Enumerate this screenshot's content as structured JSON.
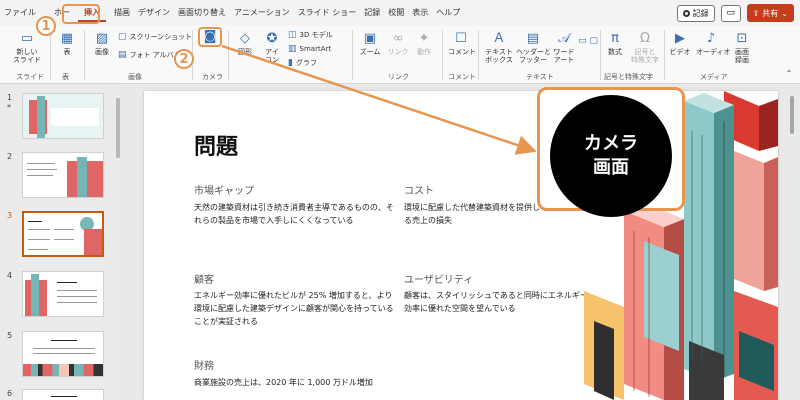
{
  "menubar": {
    "tabs": [
      "ファイル",
      "ホーム",
      "挿入",
      "画面切り替え",
      "デザイン",
      "画面切り替え",
      "アニメーション",
      "スライド ショー",
      "記録",
      "校閲",
      "表示",
      "ヘルプ"
    ],
    "active_tab_label": "挿入",
    "tab_file": "ファイル",
    "tab_home": "ホー",
    "tab_insert": "挿入",
    "tab_draw": "描画",
    "tab_design": "デザイン",
    "tab_transitions": "画面切り替え",
    "tab_animations": "アニメーション",
    "tab_slideshow": "スライド ショー",
    "tab_record": "記録",
    "tab_review": "校閲",
    "tab_view": "表示",
    "tab_help": "ヘルプ",
    "record_label": "記録",
    "share_label": "共有"
  },
  "ribbon": {
    "new_slide": "新しい\nスライド",
    "group_slides": "スライド",
    "table": "表",
    "group_table": "表",
    "images": "画像",
    "screenshot": "スクリーンショット",
    "photo_album": "フォト アルバム",
    "group_images": "画像",
    "group_camera": "カメラ",
    "shapes": "図形",
    "icons": "アイ\nコン",
    "model3d": "3D モデル",
    "smartart": "SmartArt",
    "chart": "グラフ",
    "zoom": "ズーム",
    "link": "リンク",
    "action": "動作",
    "group_link": "リンク",
    "comment": "コメント",
    "group_comment": "コメント",
    "textbox": "テキスト\nボックス",
    "header_footer": "ヘッダーと\nフッター",
    "wordart": "ワード\nアート",
    "group_text": "テキスト",
    "equation": "数式",
    "symbol": "記号と\n特殊文字",
    "group_symbols": "記号と特殊文字",
    "video": "ビデオ",
    "audio": "オーディオ",
    "screen_recording": "画面\n録画",
    "group_media": "メディア"
  },
  "thumbnails": [
    {
      "num": "1",
      "star": "*"
    },
    {
      "num": "2"
    },
    {
      "num": "3"
    },
    {
      "num": "4"
    },
    {
      "num": "5"
    },
    {
      "num": "6"
    }
  ],
  "slide": {
    "title": "問題",
    "sections": [
      {
        "heading": "市場ギャップ",
        "body": "天然の建築資材は引き続き消費者主導であるものの、それらの製品を市場で入手しにくくなっている"
      },
      {
        "heading": "コスト",
        "body": "環境に配慮した代替建築資材を提供しないことによる売上の損失"
      },
      {
        "heading": "顧客",
        "body": "エネルギー効率に優れたビルが 25% 増加すると、より環境に配慮した建築デザインに顧客が関心を持っていることが実証される"
      },
      {
        "heading": "ユーザビリティ",
        "body": "顧客は、スタイリッシュであると同時にエネルギー効率に優れた空間を望んでいる"
      },
      {
        "heading": "財務",
        "body": "商業施設の売上は、2020 年に 1,000 万ドル増加"
      }
    ]
  },
  "annotation": {
    "camera_line1": "カメラ",
    "camera_line2": "画面",
    "badge1": "1",
    "badge2": "2",
    "accent_color": "#e8954f"
  }
}
